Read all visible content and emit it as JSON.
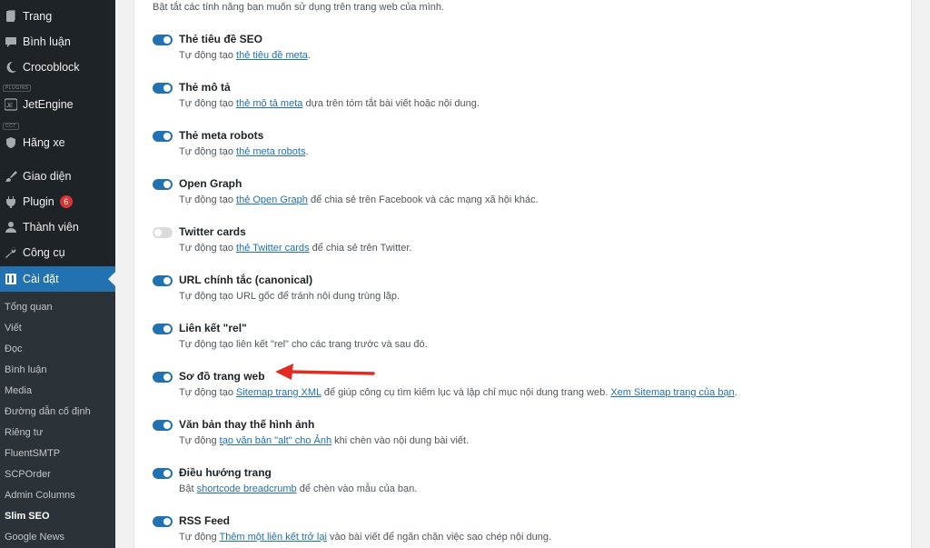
{
  "sidebar": {
    "menu": [
      {
        "label": "Trang",
        "icon": "page-icon"
      },
      {
        "label": "Bình luận",
        "icon": "comment-icon"
      },
      {
        "label": "Crocoblock",
        "icon": "crocoblock-icon"
      },
      {
        "label": "JetEngine",
        "icon": "jetengine-icon",
        "tag": "PLUGINS"
      },
      {
        "label": "Hãng xe",
        "icon": "shield-icon",
        "tag": "CCT"
      },
      {
        "label": "Giao diện",
        "icon": "brush-icon"
      },
      {
        "label": "Plugin",
        "icon": "plug-icon",
        "badge": "6"
      },
      {
        "label": "Thành viên",
        "icon": "user-icon"
      },
      {
        "label": "Công cụ",
        "icon": "wrench-icon"
      },
      {
        "label": "Cài đặt",
        "icon": "settings-icon",
        "active": true
      }
    ],
    "submenu": [
      "Tổng quan",
      "Viết",
      "Đọc",
      "Bình luận",
      "Media",
      "Đường dẫn cố định",
      "Riêng tư",
      "FluentSMTP",
      "SCPOrder",
      "Admin Columns",
      "Slim SEO",
      "Google News"
    ],
    "current_sub": "Slim SEO"
  },
  "main": {
    "intro": "Bật tắt các tính năng bạn muốn sử dụng trên trang web của mình.",
    "features": [
      {
        "title": "Thẻ tiêu đề SEO",
        "enabled": true,
        "desc_before": "Tự động tạo ",
        "link": "thẻ tiêu đề meta",
        "desc_after": "."
      },
      {
        "title": "Thẻ mô tả",
        "enabled": true,
        "desc_before": "Tự động tạo ",
        "link": "thẻ mô tả meta",
        "desc_after": " dựa trên tóm tắt bài viết hoặc nội dung."
      },
      {
        "title": "Thẻ meta robots",
        "enabled": true,
        "desc_before": "Tự động tạo ",
        "link": "thẻ meta robots",
        "desc_after": "."
      },
      {
        "title": "Open Graph",
        "enabled": true,
        "desc_before": "Tự động tạo ",
        "link": "thẻ Open Graph",
        "desc_after": " để chia sẻ trên Facebook và các mạng xã hội khác."
      },
      {
        "title": "Twitter cards",
        "enabled": false,
        "desc_before": "Tự động tạo ",
        "link": "thẻ Twitter cards",
        "desc_after": " để chia sẻ trên Twitter."
      },
      {
        "title": "URL chính tắc (canonical)",
        "enabled": true,
        "desc_before": "Tự động tạo URL gốc để tránh nội dung trùng lặp.",
        "link": "",
        "desc_after": ""
      },
      {
        "title": "Liên kết \"rel\"",
        "enabled": true,
        "desc_before": "Tự động tạo liên kết \"rel\" cho các trang trước và sau đó.",
        "link": "",
        "desc_after": ""
      },
      {
        "title": "Sơ đồ trang web",
        "enabled": true,
        "desc_before": "Tự động tạo ",
        "link": "Sitemap trang XML",
        "desc_after": " để giúp công cụ tìm kiếm lục và lập chỉ mục nội dung trang web. ",
        "link2": "Xem Sitemap trang của bạn",
        "desc_after2": "."
      },
      {
        "title": "Văn bản thay thế hình ảnh",
        "enabled": true,
        "desc_before": "Tự động ",
        "link": "tạo văn bản \"alt\" cho Ảnh",
        "desc_after": " khi chèn vào nội dung bài viết."
      },
      {
        "title": "Điều hướng trang",
        "enabled": true,
        "desc_before": "Bật ",
        "link": "shortcode breadcrumb",
        "desc_after": " để chèn vào mẫu của bạn."
      },
      {
        "title": "RSS Feed",
        "enabled": true,
        "desc_before": "Tự động ",
        "link": "Thêm một liên kết trở lại",
        "desc_after": " vào bài viết để ngăn chặn việc sao chép nội dung."
      }
    ]
  },
  "colors": {
    "accent": "#2271b1",
    "sidebar": "#1d2327",
    "arrow": "#e02b20"
  }
}
